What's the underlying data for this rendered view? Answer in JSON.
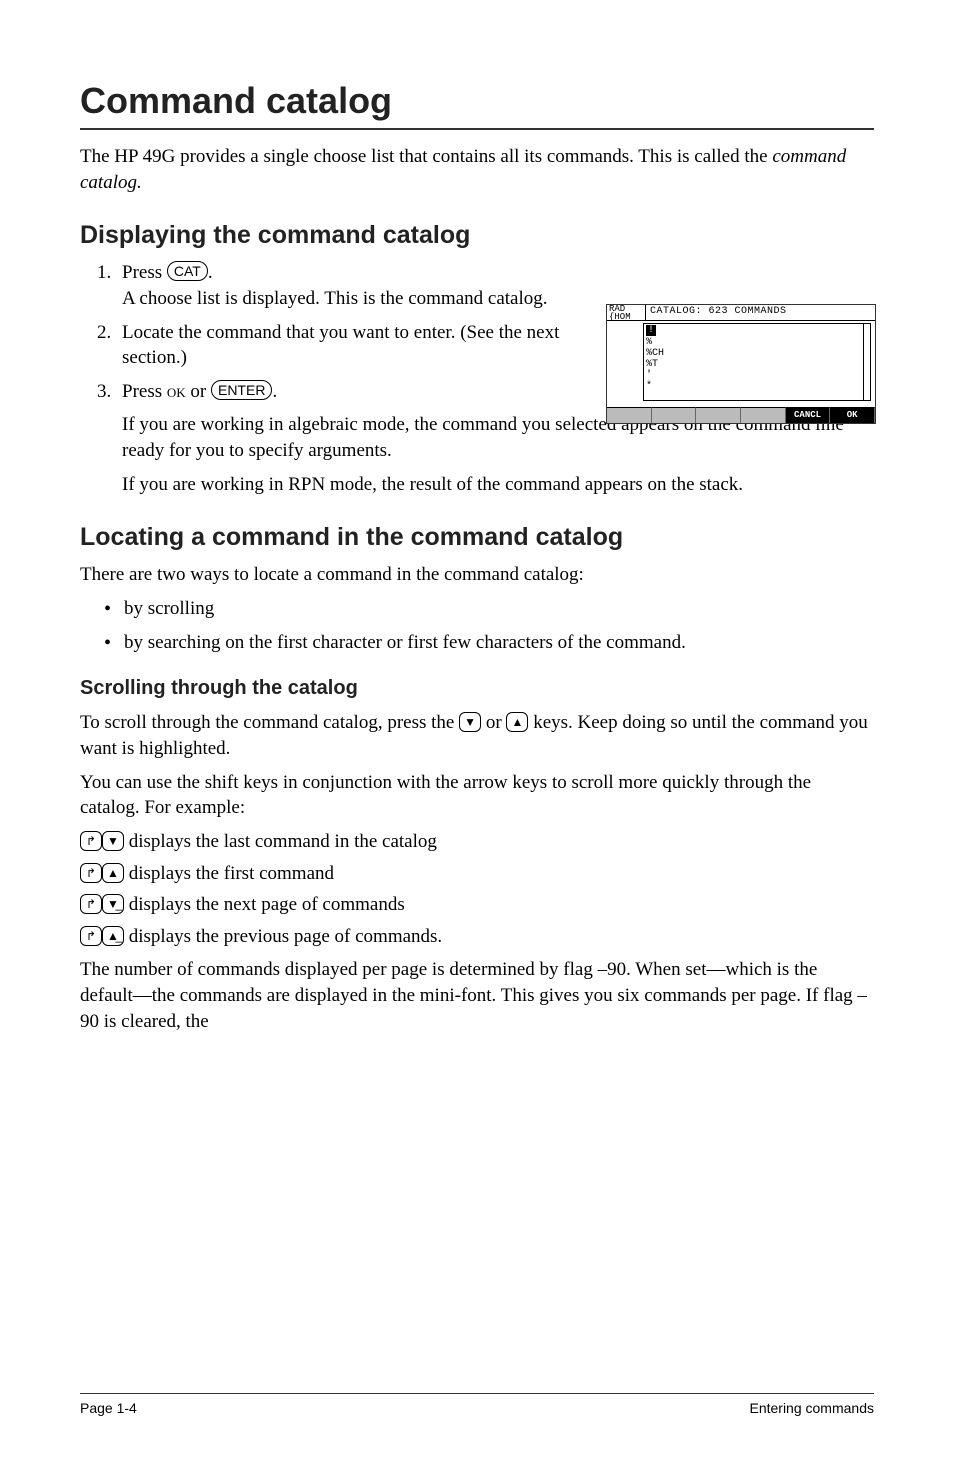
{
  "title": "Command catalog",
  "intro_a": "The HP 49G provides a single choose list that contains all its commands. This is called the ",
  "intro_b_italic": "command catalog.",
  "section1": {
    "heading": "Displaying the command catalog",
    "steps": {
      "s1_a": "Press ",
      "s1_key": "CAT",
      "s1_b": ".",
      "s1_body": "A choose list is displayed. This is the command catalog.",
      "s2": "Locate the command that you want to enter. (See the next section.)",
      "s3_a": "Press ",
      "s3_ok": "ok",
      "s3_or": " or ",
      "s3_key": "ENTER",
      "s3_b": ".",
      "s3_body1": "If you are working in algebraic mode, the command you selected appears on the command line ready for you to specify arguments.",
      "s3_body2": "If you are working in RPN mode, the result of the command appears on the stack."
    }
  },
  "screenshot": {
    "rad": "RAD",
    "chom": "{HOM",
    "title": "CATALOG: 623 COMMANDS",
    "items": [
      "!",
      "%",
      "%CH",
      "%T",
      "'",
      "*"
    ],
    "soft": [
      "",
      "",
      "",
      "",
      "CANCL",
      "OK"
    ]
  },
  "section2": {
    "heading": "Locating a command in the command catalog",
    "intro": "There are two ways to locate a command in the command catalog:",
    "bullets": {
      "b1": "by scrolling",
      "b2": "by searching on the first character or first few characters of the command."
    }
  },
  "section3": {
    "heading": "Scrolling through the catalog",
    "p1_a": "To scroll through the command catalog, press the ",
    "p1_down": "▼",
    "p1_or": " or ",
    "p1_up": "▲",
    "p1_b": " keys. Keep doing so until the command you want is highlighted.",
    "p2": "You can use the shift keys in conjunction with the arrow keys to scroll more quickly through the catalog. For example:",
    "r1_a": "↱",
    "r1_b": "▼",
    "r1_t": " displays the last command in the catalog",
    "r2_a": "↱",
    "r2_b": "▲",
    "r2_t": " displays the first command",
    "r3_a": "↱",
    "r3_b": "▼̲",
    "r3_t": " displays the next page of commands",
    "r4_a": "↱",
    "r4_b": "▲̲",
    "r4_t": " displays the previous page of commands.",
    "p3": "The number of commands displayed per page is determined by flag –90. When set—which is the default—the commands are displayed in the mini-font. This gives you six commands per page. If flag –90 is cleared, the"
  },
  "footer": {
    "left": "Page 1-4",
    "right": "Entering commands"
  }
}
